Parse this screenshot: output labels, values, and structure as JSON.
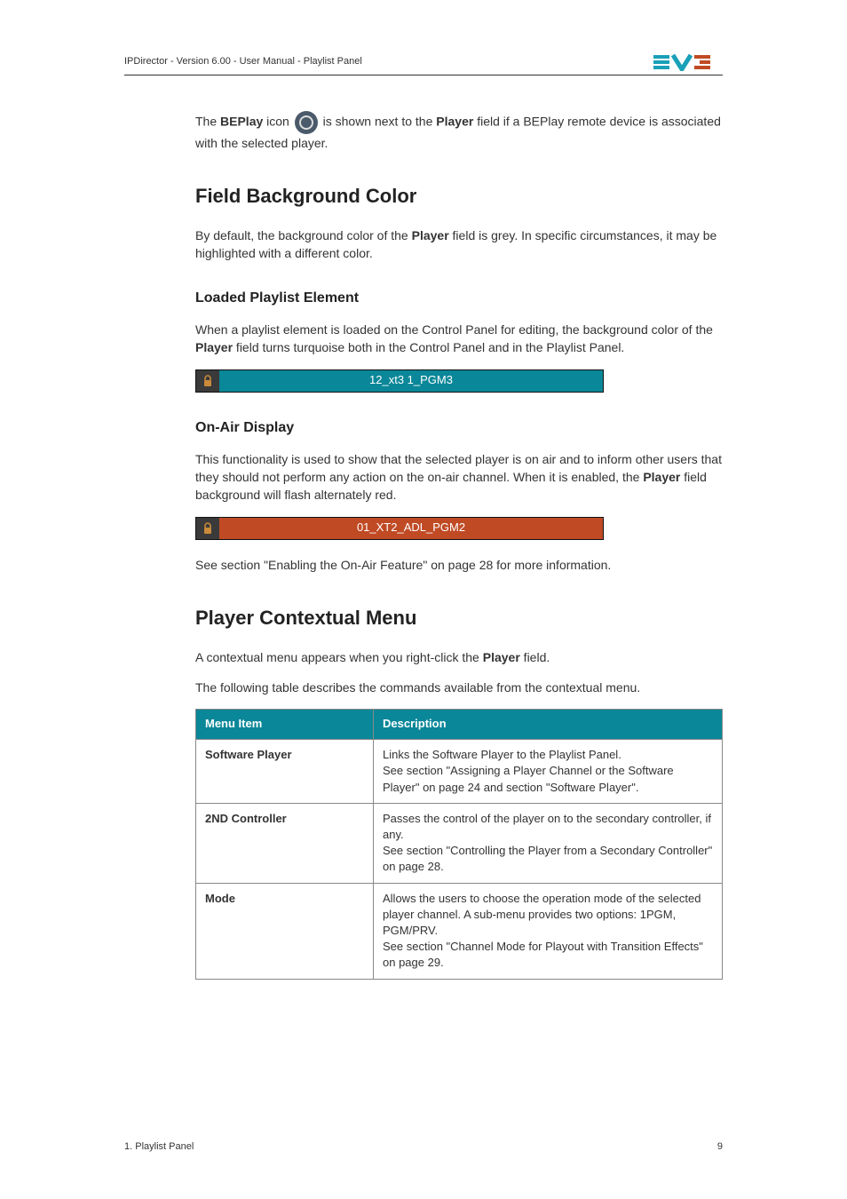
{
  "header": {
    "breadcrumb": "IPDirector - Version 6.00 - User Manual - Playlist Panel"
  },
  "intro": {
    "line1_a": "The ",
    "line1_b": "BEPlay",
    "line1_c": " icon ",
    "line1_d": " is shown next to the ",
    "line1_e": "Player",
    "line1_f": " field if a BEPlay remote device is associated with the selected player."
  },
  "section_fieldbg": {
    "title": "Field Background Color",
    "para_a": "By default, the background color of the ",
    "para_b": "Player",
    "para_c": " field is grey. In specific circumstances, it may be highlighted with a different color."
  },
  "section_loaded": {
    "title": "Loaded Playlist Element",
    "para_a": "When a playlist element is loaded on the Control Panel for editing, the background color of the ",
    "para_b": "Player",
    "para_c": " field turns turquoise both in the Control Panel and in the Playlist Panel.",
    "bar_text": "12_xt3 1_PGM3"
  },
  "section_onair": {
    "title": "On-Air Display",
    "para_a": "This functionality is used to show that the selected player is on air and to inform other users that they should not perform any action on the on-air channel. When it is enabled, the ",
    "para_b": "Player",
    "para_c": " field background will flash alternately red.",
    "bar_text": "01_XT2_ADL_PGM2",
    "see": "See section \"Enabling the On-Air Feature\" on page 28 for more information."
  },
  "section_menu": {
    "title": "Player Contextual Menu",
    "para1_a": "A contextual menu appears when you right-click the ",
    "para1_b": "Player",
    "para1_c": " field.",
    "para2": "The following table describes the commands available from the contextual menu.",
    "th_item": "Menu Item",
    "th_desc": "Description",
    "rows": [
      {
        "item": "Software Player",
        "desc": "Links the Software Player to the Playlist Panel.\nSee section \"Assigning a Player Channel or the Software Player\" on page 24 and section \"Software Player\"."
      },
      {
        "item": "2ND Controller",
        "desc": "Passes the control of the player on to the secondary controller, if any.\nSee section \"Controlling the Player from a Secondary Controller\" on page 28."
      },
      {
        "item": "Mode",
        "desc": "Allows the users to choose the operation mode of the selected player channel. A sub-menu provides two options: 1PGM, PGM/PRV.\nSee section \"Channel Mode for Playout with Transition Effects\" on page 29."
      }
    ]
  },
  "footer": {
    "left": "1. Playlist Panel",
    "right": "9"
  }
}
